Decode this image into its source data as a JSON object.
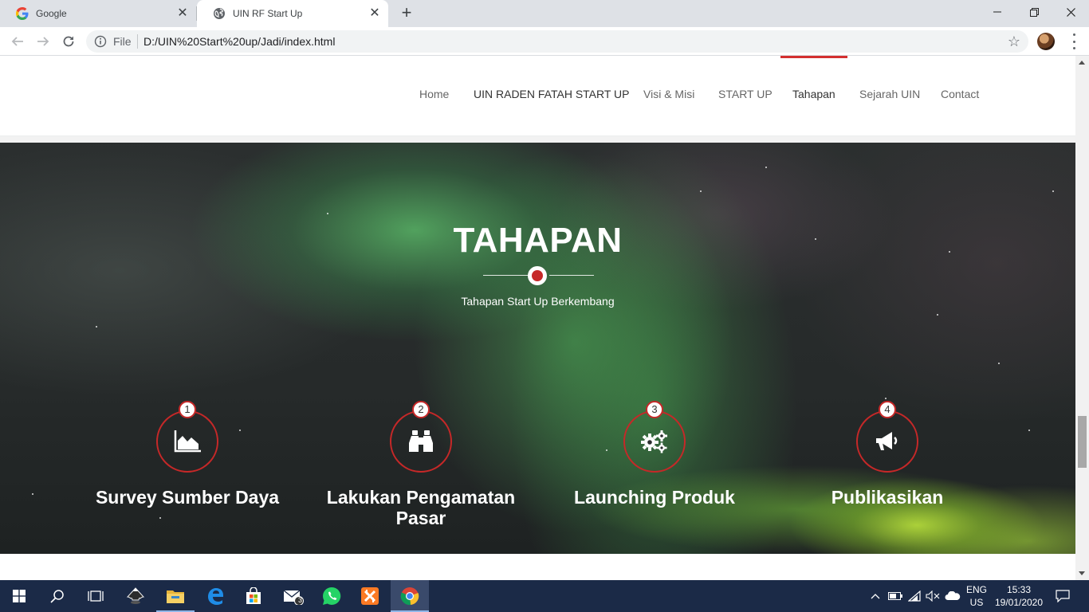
{
  "browser": {
    "tabs": [
      {
        "title": "Google",
        "active": false
      },
      {
        "title": "UIN RF Start Up",
        "active": true
      }
    ],
    "address": {
      "scheme": "File",
      "url": "D:/UIN%20Start%20up/Jadi/index.html"
    }
  },
  "site": {
    "nav": [
      {
        "label": "Home"
      },
      {
        "label": "UIN RADEN FATAH START UP"
      },
      {
        "label": "Visi & Misi"
      },
      {
        "label": "START UP"
      },
      {
        "label": "Tahapan"
      },
      {
        "label": "Sejarah UIN"
      },
      {
        "label": "Contact"
      }
    ],
    "active_nav": "Tahapan",
    "accent_color": "#c62828"
  },
  "hero": {
    "title": "TAHAPAN",
    "subtitle": "Tahapan Start Up Berkembang",
    "steps": [
      {
        "number": "1",
        "icon": "area-chart-icon",
        "label": "Survey Sumber Daya"
      },
      {
        "number": "2",
        "icon": "binoculars-icon",
        "label": "Lakukan Pengamatan Pasar"
      },
      {
        "number": "3",
        "icon": "gears-icon",
        "label": "Launching Produk"
      },
      {
        "number": "4",
        "icon": "megaphone-icon",
        "label": "Publikasikan"
      }
    ]
  },
  "taskbar": {
    "mail_badge": "3",
    "lang_top": "ENG",
    "lang_bottom": "US",
    "time": "15:33",
    "date": "19/01/2020"
  }
}
